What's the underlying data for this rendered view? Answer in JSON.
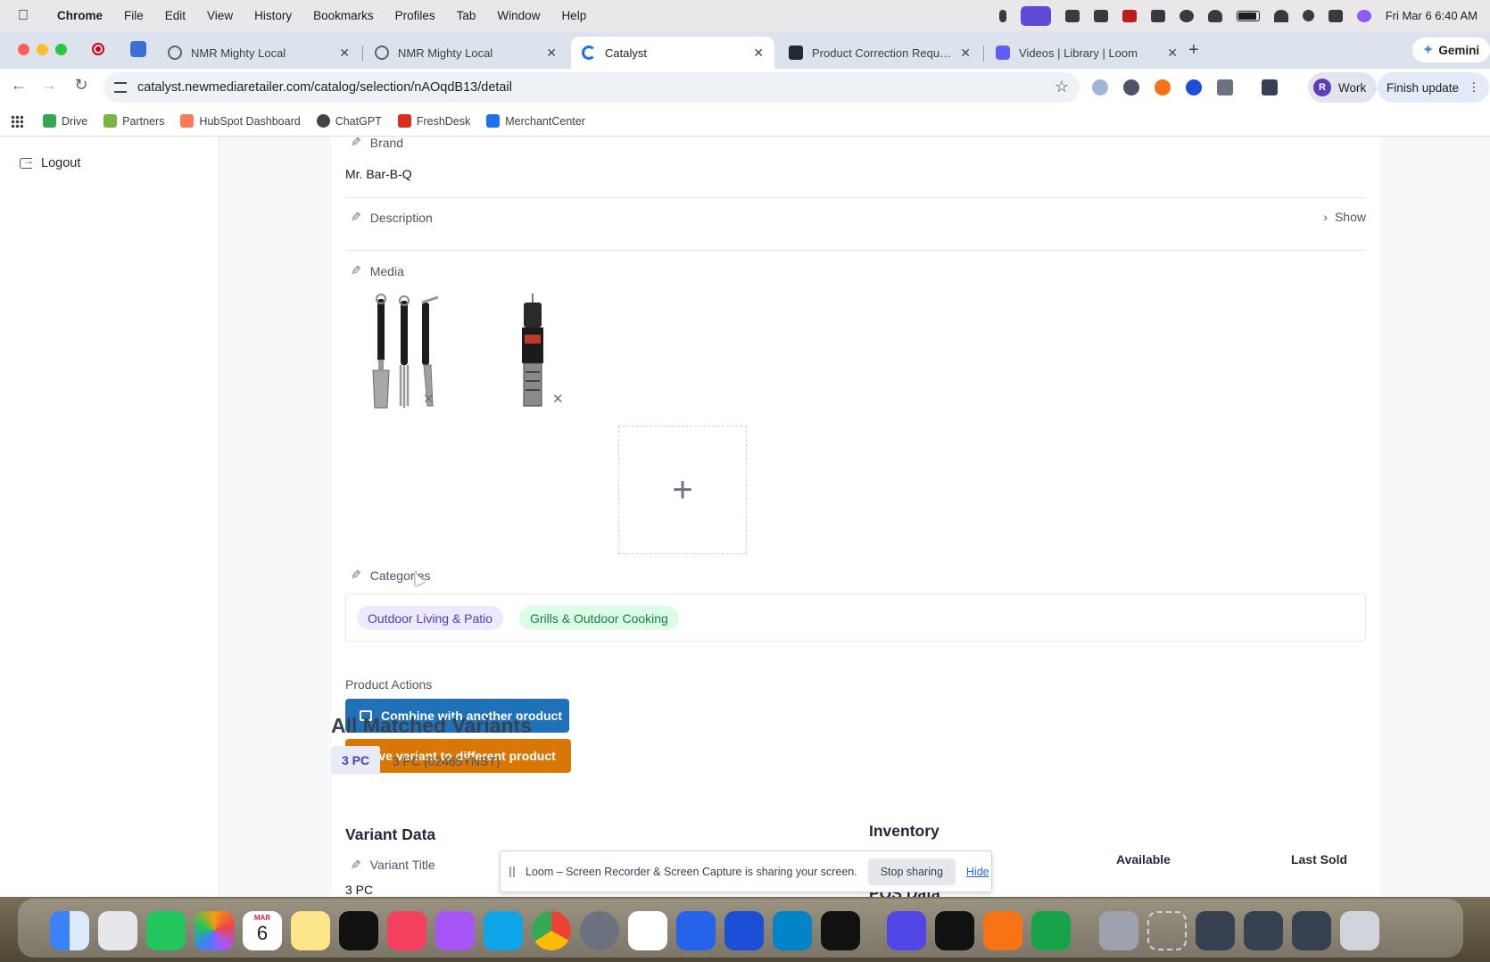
{
  "menubar": {
    "app": "Chrome",
    "items": [
      "File",
      "Edit",
      "View",
      "History",
      "Bookmarks",
      "Profiles",
      "Tab",
      "Window",
      "Help"
    ],
    "clock": "Fri Mar 6  6:40 AM"
  },
  "tabs": [
    {
      "label": "NMR Mighty Local",
      "fav_color": "#5f6368"
    },
    {
      "label": "NMR Mighty Local",
      "fav_color": "#5f6368"
    },
    {
      "label": "Catalyst",
      "fav_color": "#1a73e8"
    },
    {
      "label": "Product Correction Requests",
      "fav_color": "#1f2937"
    },
    {
      "label": "Videos | Library | Loom",
      "fav_color": "#625df5"
    }
  ],
  "gemini_label": "Gemini",
  "omnibox": {
    "url": "catalyst.newmediaretailer.com/catalog/selection/nAOqdB13/detail"
  },
  "profile": {
    "initial": "R",
    "label": "Work"
  },
  "finish_update": "Finish update",
  "bookmarks": [
    {
      "label": "Drive",
      "color": "#34a853"
    },
    {
      "label": "Partners",
      "color": "#7cb342"
    },
    {
      "label": "HubSpot Dashboard",
      "color": "#ff7a59"
    },
    {
      "label": "ChatGPT",
      "color": "#444444"
    },
    {
      "label": "FreshDesk",
      "color": "#d92d20"
    },
    {
      "label": "MerchantCenter",
      "color": "#1a73e8"
    }
  ],
  "sidebar": {
    "logout": "Logout"
  },
  "product": {
    "brand_label": "Brand",
    "brand_value": "Mr. Bar-B-Q",
    "description_label": "Description",
    "show_label": "Show",
    "media_label": "Media",
    "categories_label": "Categories",
    "categories": [
      "Outdoor Living & Patio",
      "Grills & Outdoor Cooking"
    ],
    "actions_title": "Product Actions",
    "combine_label": "Combine with another product",
    "move_label": "Move variant to different product"
  },
  "matched": {
    "title": "All Matched Variants",
    "chip": "3 PC",
    "variant_label": "3 PC (02465YNST)"
  },
  "variant_data": {
    "title": "Variant Data",
    "variant_title_label": "Variant Title",
    "variant_title_value": "3 PC",
    "inventory_title": "Inventory",
    "col_available": "Available",
    "col_last_sold": "Last Sold",
    "pos_title": "POS Data"
  },
  "loom": {
    "message": "Loom – Screen Recorder & Screen Capture is sharing your screen.",
    "stop": "Stop sharing",
    "hide": "Hide"
  },
  "dock": {
    "calendar_month": "MAR",
    "calendar_day": "6"
  }
}
